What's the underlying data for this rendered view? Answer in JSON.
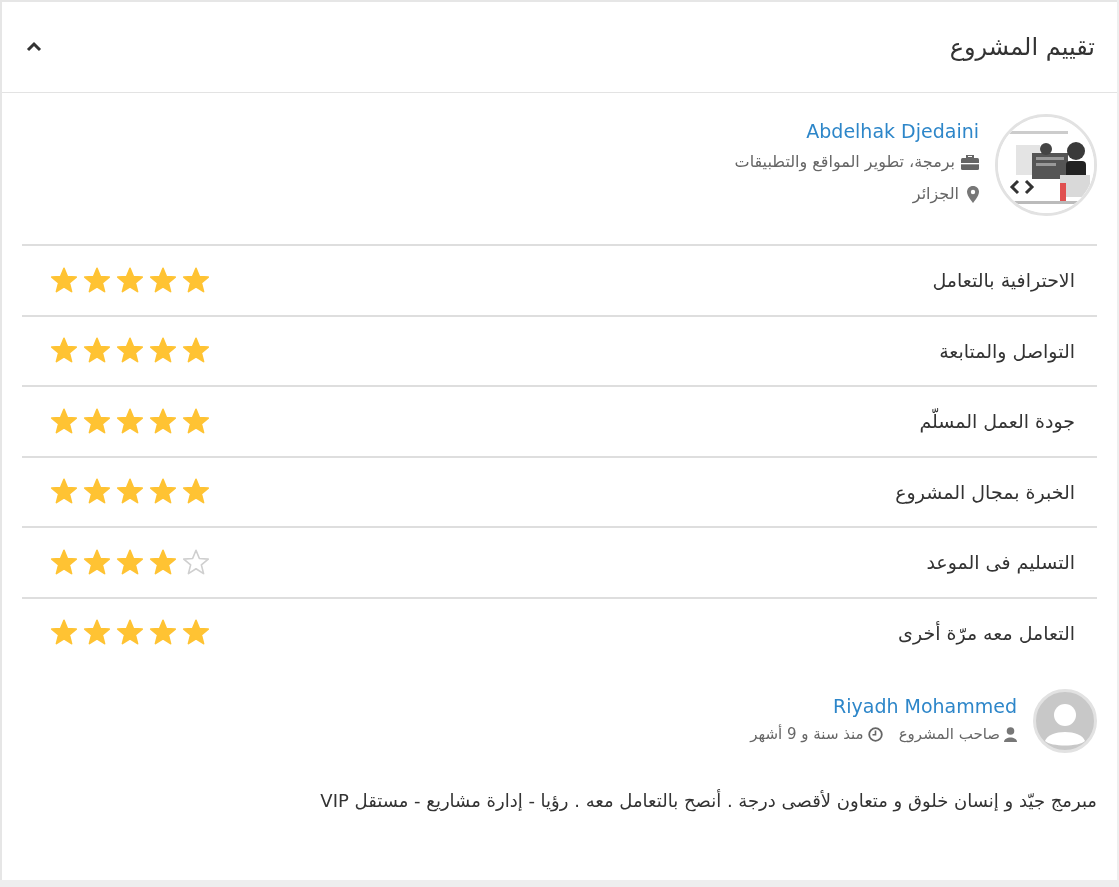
{
  "panel": {
    "title": "تقييم المشروع",
    "expanded": true
  },
  "freelancer": {
    "name": "Abdelhak Djedaini",
    "specialty": "برمجة، تطوير المواقع والتطبيقات",
    "country": "الجزائر"
  },
  "ratings": [
    {
      "label": "الاحترافية بالتعامل",
      "stars": 5
    },
    {
      "label": "التواصل والمتابعة",
      "stars": 5
    },
    {
      "label": "جودة العمل المسلّم",
      "stars": 5
    },
    {
      "label": "الخبرة بمجال المشروع",
      "stars": 5
    },
    {
      "label": "التسليم فى الموعد",
      "stars": 4
    },
    {
      "label": "التعامل معه مرّة أخرى",
      "stars": 5
    }
  ],
  "review": {
    "author": "Riyadh Mohammed",
    "role": "صاحب المشروع",
    "time": "منذ سنة و 9 أشهر",
    "comment": "مبرمج جيّد و إنسان خلوق و متعاون لأقصى درجة . أنصح بالتعامل معه . رؤيا - إدارة مشاريع - مستقل VIP"
  }
}
